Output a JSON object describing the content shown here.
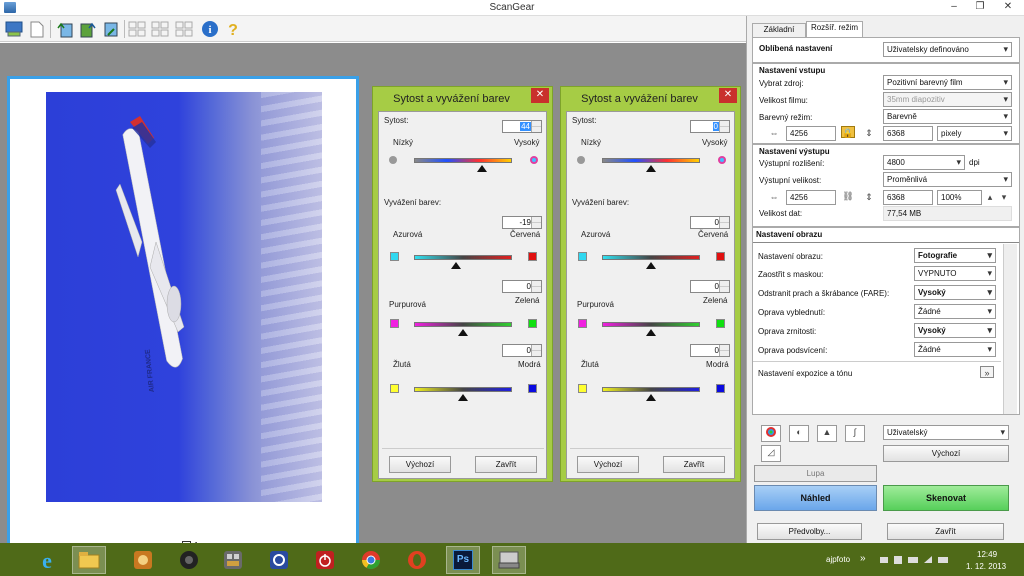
{
  "window": {
    "title": "ScanGear",
    "minimize": "–",
    "maximize": "❐",
    "close": "✕"
  },
  "toolbar": {
    "icons": [
      "scanner-preview-icon",
      "new-document-icon",
      "rotate-left-icon",
      "rotate-right-icon",
      "flip-icon",
      "select-all-icon",
      "thumbnail-grid-icon",
      "multi-select-icon",
      "info-icon",
      "help-icon"
    ]
  },
  "preview": {
    "checkbox_mark": "✔",
    "frame_number": "1",
    "airline_text": "AIR FRANCE"
  },
  "dialogs": [
    {
      "title": "Sytost a vyvážení barev",
      "saturation_label": "Sytost:",
      "saturation_value": "44",
      "low_label": "Nízký",
      "high_label": "Vysoký",
      "color_balance_label": "Vyvážení barev:",
      "cyan_red_value": "-19",
      "cyan_label": "Azurová",
      "red_label": "Červená",
      "magenta_green_value": "0",
      "magenta_label": "Purpurová",
      "green_label": "Zelená",
      "yellow_blue_value": "0",
      "yellow_label": "Žlutá",
      "blue_label": "Modrá",
      "default_button": "Výchozí",
      "close_button": "Zavřít",
      "levels": {
        "saturation": 0.69,
        "cyan_red": 0.43,
        "magenta_green": 0.5,
        "yellow_blue": 0.5
      }
    },
    {
      "title": "Sytost a vyvážení barev",
      "saturation_label": "Sytost:",
      "saturation_value": "0",
      "low_label": "Nízký",
      "high_label": "Vysoký",
      "color_balance_label": "Vyvážení barev:",
      "cyan_red_value": "0",
      "cyan_label": "Azurová",
      "red_label": "Červená",
      "magenta_green_value": "0",
      "magenta_label": "Purpurová",
      "green_label": "Zelená",
      "yellow_blue_value": "0",
      "yellow_label": "Žlutá",
      "blue_label": "Modrá",
      "default_button": "Výchozí",
      "close_button": "Zavřít",
      "levels": {
        "saturation": 0.5,
        "cyan_red": 0.5,
        "magenta_green": 0.5,
        "yellow_blue": 0.5
      }
    }
  ],
  "panel": {
    "tabs": [
      "Základní režim",
      "Rozšíř. režim"
    ],
    "favorites_label": "Oblíbená nastavení",
    "favorites_value": "Uživatelsky definováno",
    "input_section": "Nastavení vstupu",
    "source_label": "Vybrat zdroj:",
    "source_value": "Pozitivní barevný film",
    "film_size_label": "Velikost filmu:",
    "film_size_value": "35mm diapozitiv",
    "color_mode_label": "Barevný režim:",
    "color_mode_value": "Barevně",
    "input_width": "4256",
    "input_height": "6368",
    "input_unit": "pixely",
    "output_section": "Nastavení výstupu",
    "resolution_label": "Výstupní rozlišení:",
    "resolution_value": "4800",
    "resolution_unit": "dpi",
    "output_size_label": "Výstupní velikost:",
    "output_size_value": "Proměnlivá",
    "output_width": "4256",
    "output_height": "6368",
    "output_scale": "100%",
    "data_size_label": "Velikost dat:",
    "data_size_value": "77,54 MB",
    "image_section": "Nastavení obrazu",
    "image_settings": [
      {
        "label": "Nastavení obrazu:",
        "value": "Fotografie",
        "bold": true
      },
      {
        "label": "Zaostřit s maskou:",
        "value": "VYPNUTO",
        "bold": false
      },
      {
        "label": "Odstranit prach a škrábance (FARE):",
        "value": "Vysoký",
        "bold": true
      },
      {
        "label": "Oprava vyblednutí:",
        "value": "Žádné",
        "bold": false
      },
      {
        "label": "Oprava zrnitosti:",
        "value": "Vysoký",
        "bold": true
      },
      {
        "label": "Oprava podsvícení:",
        "value": "Žádné",
        "bold": false
      }
    ],
    "exposure_label": "Nastavení expozice a tónu",
    "tone_preset_value": "Uživatelský",
    "tone_default_button": "Výchozí",
    "zoom_button": "Lupa",
    "preview_button": "Náhled",
    "scan_button": "Skenovat",
    "preferences_button": "Předvolby...",
    "close_button": "Zavřít"
  },
  "taskbar": {
    "apps": [
      "internet-explorer-icon",
      "file-explorer-icon",
      "app-icon-1",
      "speaker-app-icon",
      "grid-app-icon",
      "settings-app-icon",
      "power-app-icon",
      "chrome-icon",
      "opera-icon",
      "photoshop-icon",
      "scangear-icon"
    ],
    "photoshop_text": "Ps",
    "tray_user": "ajpfoto",
    "tray_chevron": "»",
    "time": "12:49",
    "date": "1. 12. 2013"
  },
  "colors": {
    "dialog_frame": "#a6cc45",
    "preview_button": "#6aa6ea",
    "scan_button": "#56cf5a",
    "taskbar": "#4f6a18",
    "selection_border": "#3aa0e8"
  }
}
